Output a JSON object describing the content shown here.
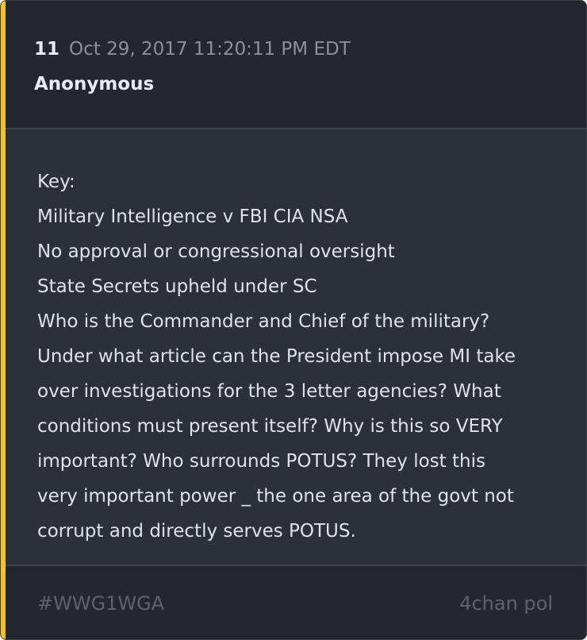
{
  "post": {
    "number": "11",
    "timestamp": "Oct 29, 2017 11:20:11 PM EDT",
    "author": "Anonymous",
    "body_lines": [
      "Key:",
      "Military Intelligence v FBI CIA NSA",
      "No approval or congressional oversight",
      "State Secrets upheld under SC",
      "Who is the Commander and Chief of the military?",
      "Under what article can the President impose MI take",
      "over investigations for the 3 letter agencies? What",
      "conditions must present itself? Why is this so VERY",
      "important? Who surrounds POTUS? They lost this",
      "very important power _ the one area of the govt not",
      "corrupt and directly serves POTUS."
    ],
    "hashtag": "#WWG1WGA",
    "source": "4chan pol"
  },
  "colors": {
    "accent": "#f2c12e",
    "card_background": "#2c3038",
    "header_background": "#24272e"
  }
}
